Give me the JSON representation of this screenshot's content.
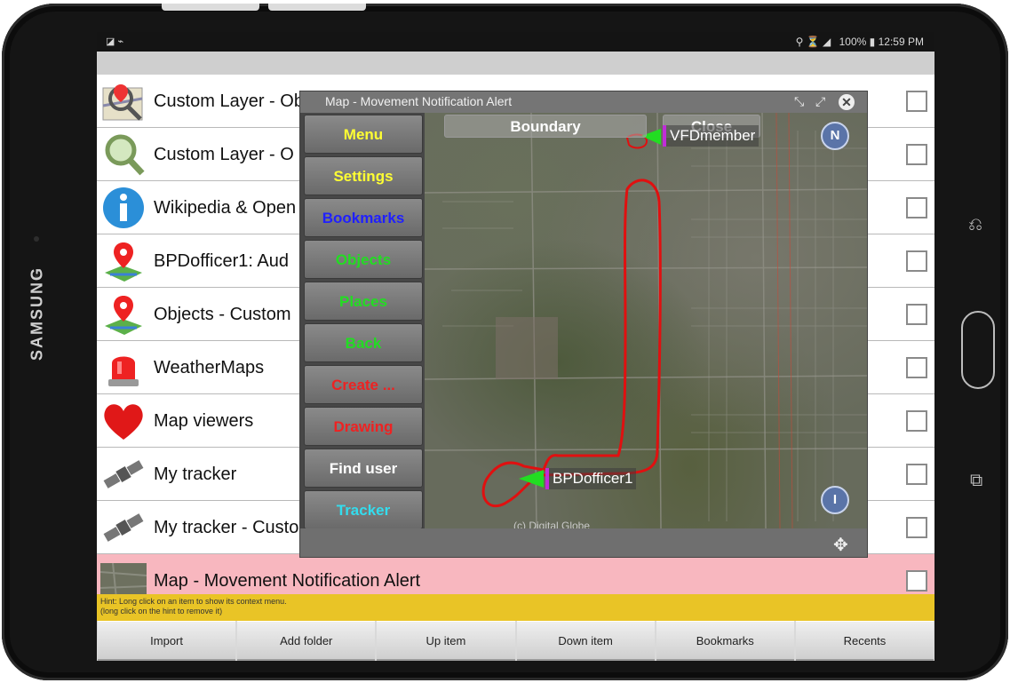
{
  "device": {
    "brand": "SAMSUNG"
  },
  "statusbar": {
    "left_icons": "◪ ⌁",
    "signal": "⚲ ⏳ ◢",
    "battery": "100%",
    "time": "12:59 PM"
  },
  "list": {
    "items": [
      {
        "label": "Custom Layer - Object search: audio",
        "icon": "magnifier-map-icon",
        "checked": false
      },
      {
        "label": "Custom Layer - O",
        "icon": "magnifier-icon",
        "checked": false
      },
      {
        "label": "Wikipedia & Open",
        "icon": "info-icon",
        "checked": false
      },
      {
        "label": "BPDofficer1: Aud",
        "icon": "map-pin-icon",
        "checked": false
      },
      {
        "label": "Objects - Custom",
        "icon": "map-pin-icon",
        "checked": false
      },
      {
        "label": "WeatherMaps",
        "icon": "siren-icon",
        "checked": false
      },
      {
        "label": "Map viewers",
        "icon": "heart-icon",
        "checked": false
      },
      {
        "label": "My tracker",
        "icon": "satellite-icon",
        "checked": false
      },
      {
        "label": "My tracker - Custo",
        "icon": "satellite-icon",
        "checked": false
      },
      {
        "label": "Map - Movement Notification Alert",
        "icon": "map-thumbnail-icon",
        "checked": false,
        "selected": true
      }
    ]
  },
  "hint": {
    "line1": "Hint: Long click on an item to show its context menu.",
    "line2": "(long click on the hint to remove it)"
  },
  "bottom_bar": {
    "buttons": [
      "Import",
      "Add folder",
      "Up item",
      "Down item",
      "Bookmarks",
      "Recents"
    ]
  },
  "map_window": {
    "title": "Map - Movement Notification Alert",
    "menu": [
      {
        "label": "Menu",
        "color": "#ffff33"
      },
      {
        "label": "Settings",
        "color": "#ffff33"
      },
      {
        "label": "Bookmarks",
        "color": "#2020ff"
      },
      {
        "label": "Objects",
        "color": "#22dd22"
      },
      {
        "label": "Places",
        "color": "#22dd22"
      },
      {
        "label": "Back",
        "color": "#22dd22"
      },
      {
        "label": "Create ...",
        "color": "#ee2222"
      },
      {
        "label": "Drawing",
        "color": "#ee2222"
      },
      {
        "label": "Find user",
        "color": "#ffffff"
      },
      {
        "label": "Tracker",
        "color": "#33ddee"
      }
    ],
    "boundary_label": "Boundary",
    "close_label": "Close",
    "compass_label": "N",
    "info_label": "I",
    "marker_top": "VFDmember",
    "marker_bottom": "BPDofficer1",
    "copyright": "(c) Digital Globe"
  },
  "colors": {
    "selected_row": "#f8b7bf",
    "hint_bar": "#e9c426",
    "boundary_line": "#e01010",
    "marker_arrow": "#22dd22"
  }
}
